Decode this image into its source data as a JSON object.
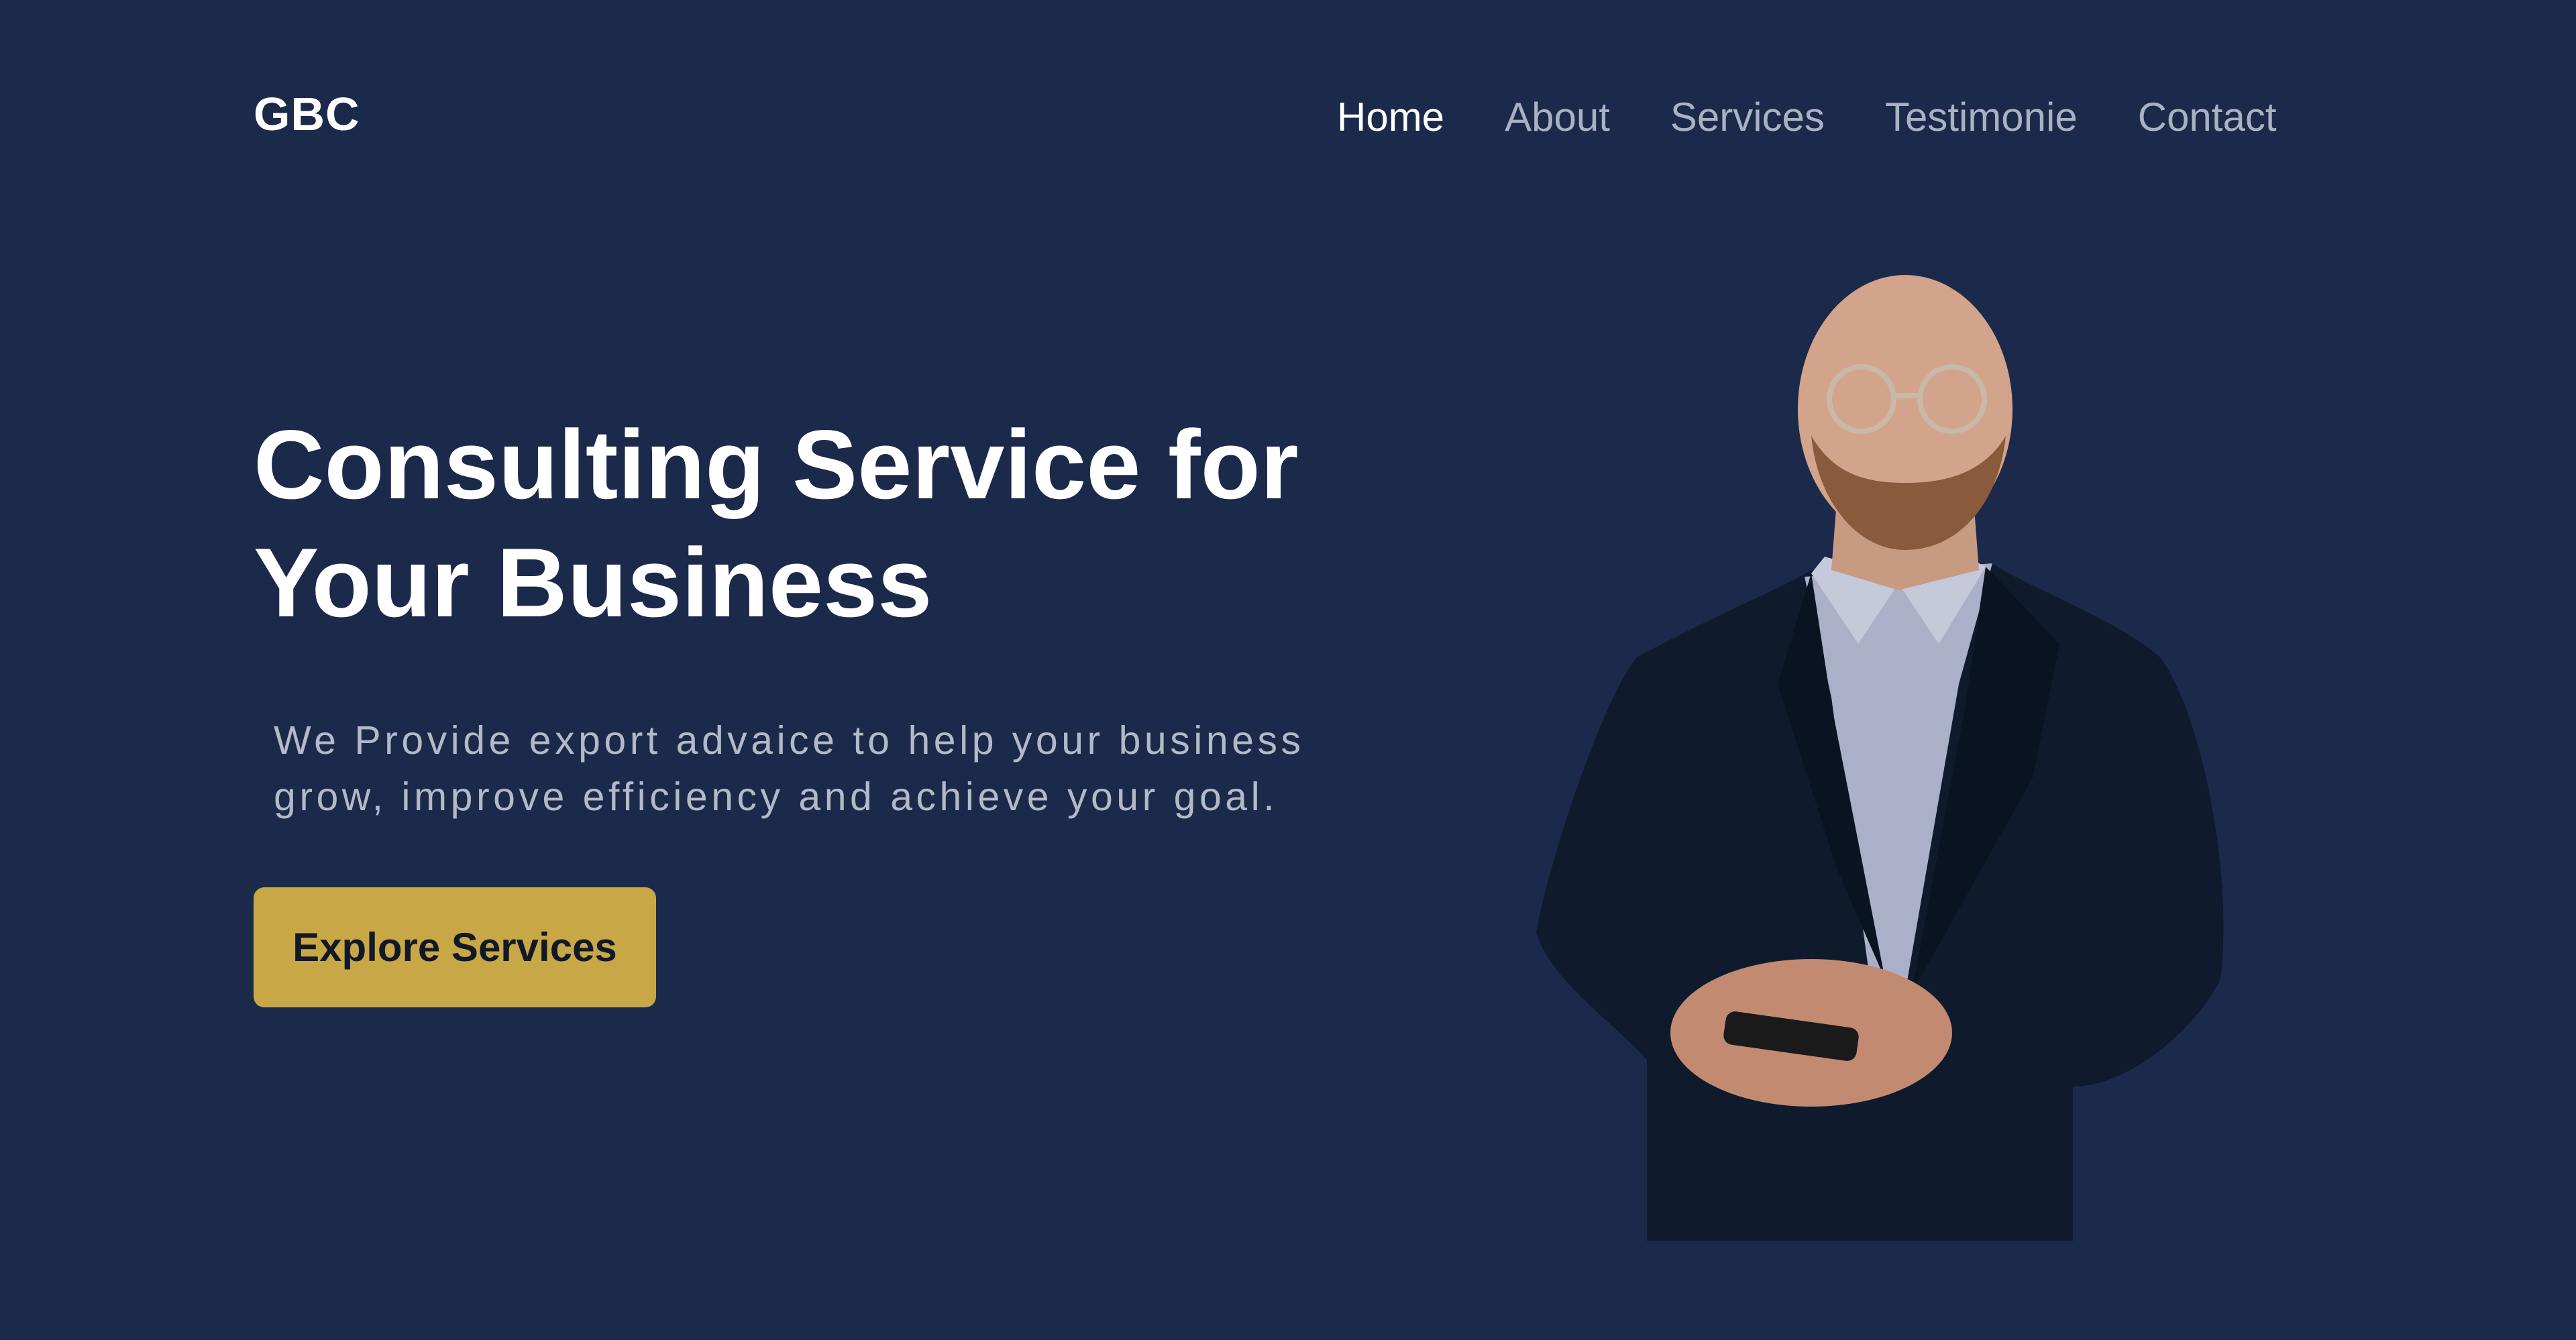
{
  "header": {
    "logo": "GBC",
    "nav": [
      {
        "label": "Home",
        "active": true
      },
      {
        "label": "About",
        "active": false
      },
      {
        "label": "Services",
        "active": false
      },
      {
        "label": "Testimonie",
        "active": false
      },
      {
        "label": "Contact",
        "active": false
      }
    ]
  },
  "hero": {
    "title": "Consulting Service  for\nYour Business",
    "subtitle": "We Provide export advaice to help your business\ngrow, improve efficiency and achieve your goal.",
    "cta_label": "Explore Services"
  },
  "colors": {
    "background": "#1b2a4b",
    "accent": "#c8a846",
    "nav_active": "#ffffff",
    "nav_inactive": "#aab2c2",
    "subtitle": "#b3b9c6"
  }
}
